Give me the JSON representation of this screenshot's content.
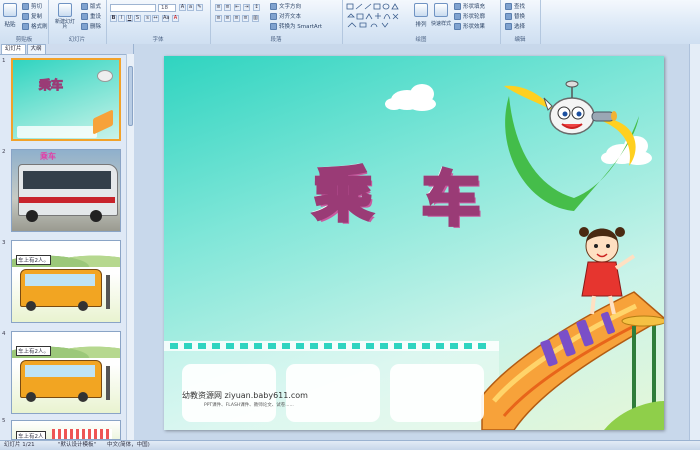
{
  "ribbon": {
    "groups": [
      {
        "label": "剪贴板"
      },
      {
        "label": "幻灯片"
      },
      {
        "label": "字体"
      },
      {
        "label": "段落"
      },
      {
        "label": "绘图"
      },
      {
        "label": "编辑"
      }
    ],
    "clipboard": {
      "paste": "粘贴",
      "cut": "剪切",
      "copy": "复制",
      "format_painter": "格式刷"
    },
    "slides": {
      "new_slide": "新建幻灯片",
      "layout": "版式",
      "reset": "重设",
      "delete": "删除"
    },
    "font": {
      "font_name": "",
      "font_size": "18"
    },
    "paragraph": {
      "text_direction": "文字方向",
      "align_text": "对齐文本",
      "smartart": "转换为 SmartArt"
    },
    "drawing": {
      "arrange": "排列",
      "quick_styles": "快速样式",
      "shape_fill": "形状填充",
      "shape_outline": "形状轮廓",
      "shape_effects": "形状效果"
    },
    "editing": {
      "find": "查找",
      "replace": "替换",
      "select": "选择"
    }
  },
  "left_pane": {
    "tabs": [
      "幻灯片",
      "大纲"
    ],
    "thumbnails": [
      {
        "num": "1",
        "title": "乘车"
      },
      {
        "num": "2",
        "title": "乘车"
      },
      {
        "num": "3",
        "caption": "车上有2人。"
      },
      {
        "num": "4",
        "caption": "车上有2人。"
      },
      {
        "num": "5",
        "caption": "车上有2人"
      }
    ]
  },
  "slide": {
    "title": [
      "乘",
      "车"
    ],
    "footer_main": "幼教资源网 ziyuan.baby611.com",
    "footer_sub": "PPT课件、FLASH课件、教师论文、试卷......"
  },
  "status": {
    "slide_info": "幻灯片 1/21",
    "theme": "\"默认设计模板\"",
    "language": "中文(简体，中国)"
  },
  "colors": {
    "accent": "#9a3b76",
    "ribbon_bg": "#dbe8f6",
    "slide_top": "#2fd4c0",
    "selection": "#f2a22a"
  }
}
